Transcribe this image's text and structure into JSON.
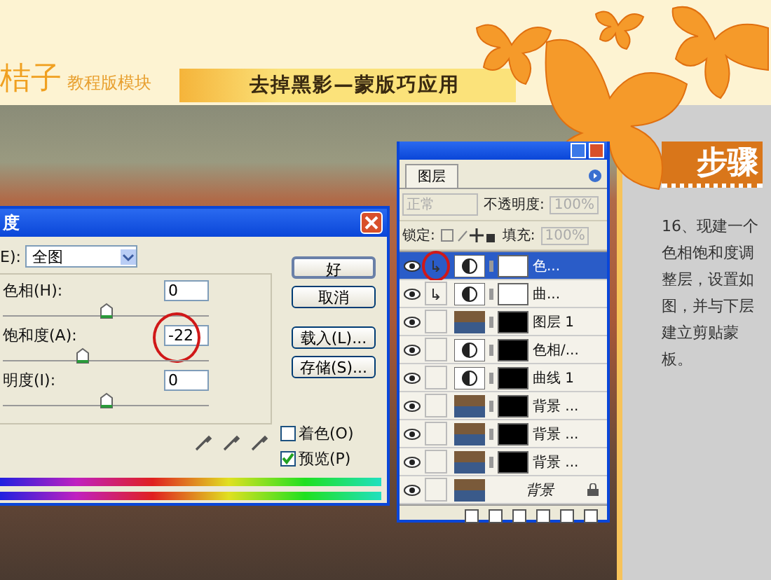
{
  "header": {
    "brand": "桔子",
    "section": "教程版模块",
    "title": "去掉黑影—蒙版巧应用"
  },
  "dialog": {
    "title": "度",
    "edit_label": "E):",
    "edit_value": "全图",
    "sliders": [
      {
        "label": "色相(H):",
        "value": "0",
        "level": 0.5,
        "highlighted": false
      },
      {
        "label": "饱和度(A):",
        "value": "-22",
        "level": 0.39,
        "highlighted": true
      },
      {
        "label": "明度(I):",
        "value": "0",
        "level": 0.5,
        "highlighted": false
      }
    ],
    "buttons": [
      "好",
      "取消",
      "载入(L)...",
      "存储(S)..."
    ],
    "checkboxes": [
      {
        "label": "着色(O)",
        "checked": false
      },
      {
        "label": "预览(P)",
        "checked": true
      }
    ]
  },
  "layers": {
    "tab": "图层",
    "blend": "正常",
    "opacity_label": "不透明度:",
    "opacity": "100%",
    "lock_label": "锁定:",
    "fill_label": "填充:",
    "fill": "100%",
    "items": [
      {
        "name": "色...",
        "kind": "adjustment",
        "has_mask": true,
        "mask_light": true,
        "clipped": true,
        "selected": true,
        "highlighted": true
      },
      {
        "name": "曲...",
        "kind": "adjustment",
        "has_mask": true,
        "mask_light": true,
        "clipped": true,
        "selected": false,
        "highlighted": false
      },
      {
        "name": "图层 1",
        "kind": "pixel",
        "has_mask": true,
        "mask_light": false,
        "clipped": false,
        "selected": false,
        "highlighted": false
      },
      {
        "name": "色相/...",
        "kind": "adjustment",
        "has_mask": true,
        "mask_light": false,
        "clipped": false,
        "selected": false,
        "highlighted": false
      },
      {
        "name": "曲线 1",
        "kind": "adjustment",
        "has_mask": true,
        "mask_light": false,
        "clipped": false,
        "selected": false,
        "highlighted": false
      },
      {
        "name": "背景 ...",
        "kind": "pixel",
        "has_mask": true,
        "mask_light": false,
        "clipped": false,
        "selected": false,
        "highlighted": false
      },
      {
        "name": "背景 ...",
        "kind": "pixel",
        "has_mask": true,
        "mask_light": false,
        "clipped": false,
        "selected": false,
        "highlighted": false
      },
      {
        "name": "背景 ...",
        "kind": "pixel",
        "has_mask": true,
        "mask_light": false,
        "clipped": false,
        "selected": false,
        "highlighted": false
      },
      {
        "name": "背景",
        "kind": "background",
        "has_mask": false,
        "clipped": false,
        "selected": false,
        "highlighted": false
      }
    ]
  },
  "step": {
    "heading": "步骤",
    "text": "16、现建一个色相饱和度调整层，设置如图，并与下层建立剪贴蒙板。"
  }
}
